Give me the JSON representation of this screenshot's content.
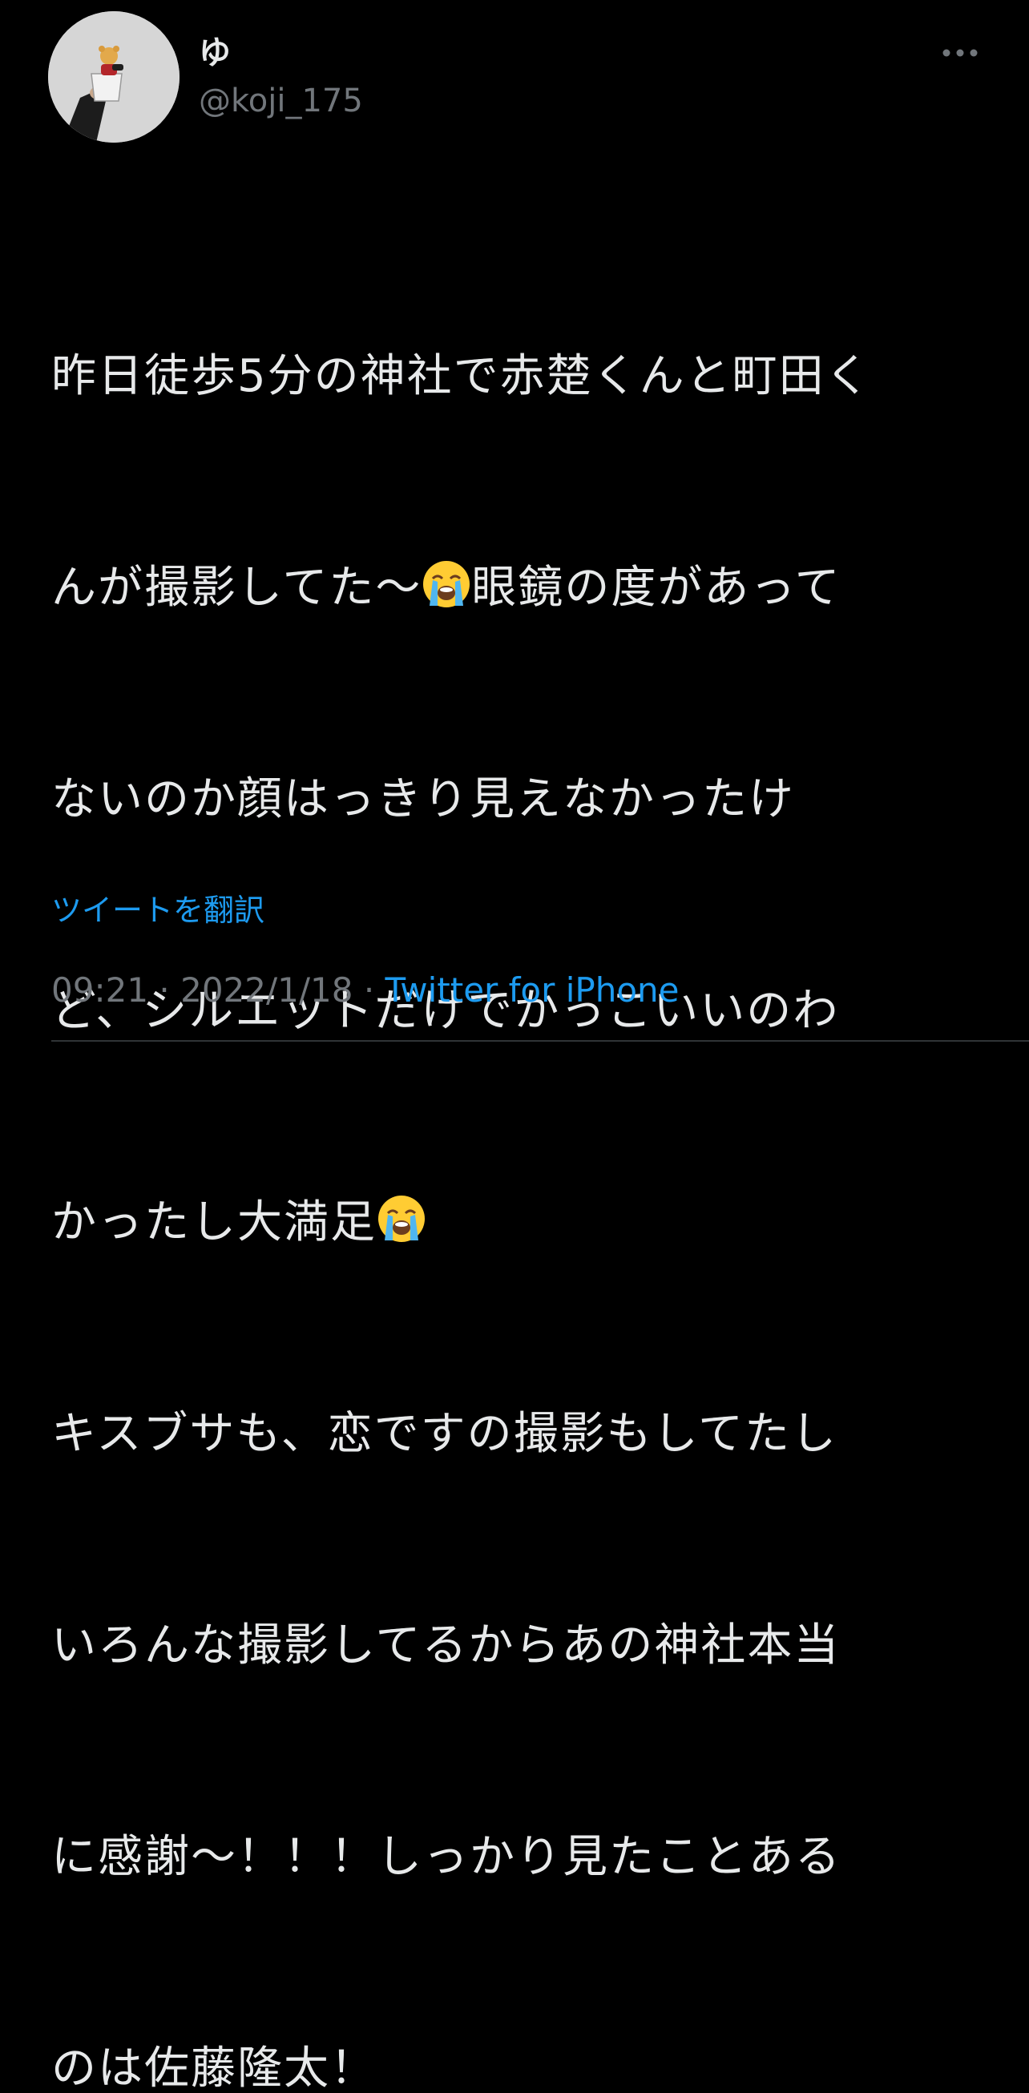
{
  "user": {
    "display_name": "ゆ",
    "handle": "@koji_175",
    "avatar_icon": "profile-photo-avatar"
  },
  "actions": {
    "more_icon": "more-horizontal-icon"
  },
  "tweet": {
    "lines": [
      "昨日徒歩5分の神社で赤楚くんと町田く",
      "んが撮影してた〜",
      "眼鏡の度があって",
      "ないのか顔はっきり見えなかったけ",
      "ど、シルエットだけでかっこいいのわ",
      "かったし大満足",
      "キスブサも、恋ですの撮影もしてたし",
      "いろんな撮影してるからあの神社本当",
      "に感謝〜！！！しっかり見たことある",
      "のは佐藤隆太！"
    ],
    "emoji": "loudly-crying-face"
  },
  "translate_label": "ツイートを翻訳",
  "meta": {
    "time": "09:21",
    "separator": " · ",
    "date": "2022/1/18",
    "source": "Twitter for iPhone"
  },
  "colors": {
    "background": "#000000",
    "text": "#e7e9ea",
    "secondary": "#71767b",
    "link": "#1d9bf0",
    "divider": "#2f3336"
  }
}
